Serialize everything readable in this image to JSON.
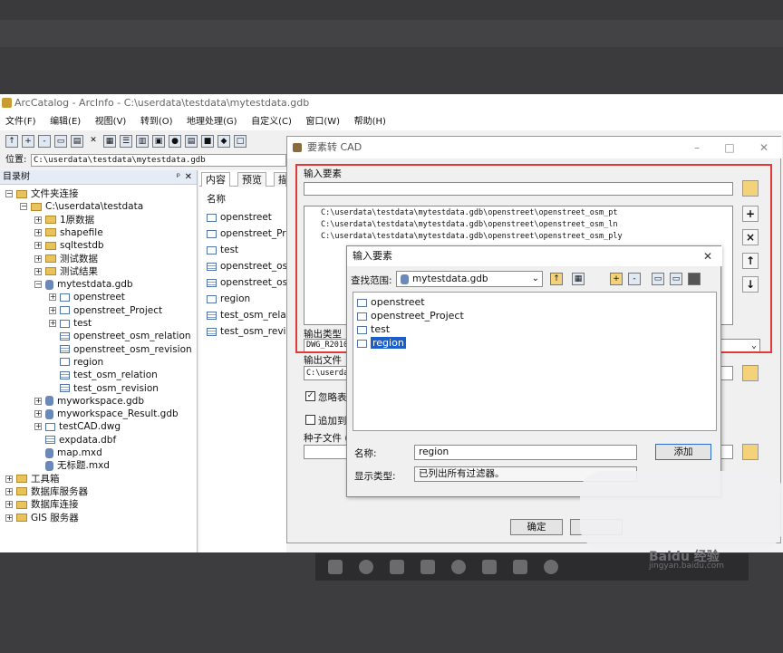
{
  "app": {
    "title": "ArcCatalog - ArcInfo - C:\\userdata\\testdata\\mytestdata.gdb",
    "menu": [
      "文件(F)",
      "编辑(E)",
      "视图(V)",
      "转到(O)",
      "地理处理(G)",
      "自定义(C)",
      "窗口(W)",
      "帮助(H)"
    ],
    "location_label": "位置:",
    "location_value": "C:\\userdata\\testdata\\mytestdata.gdb"
  },
  "tree": {
    "header": "目录树",
    "pin": "ᵖ",
    "close": "✕",
    "items": [
      {
        "label": "文件夹连接",
        "level": 0,
        "icon": "folder"
      },
      {
        "label": "C:\\userdata\\testdata",
        "level": 1,
        "icon": "folder"
      },
      {
        "label": "1原数据",
        "level": 2,
        "icon": "folder"
      },
      {
        "label": "shapefile",
        "level": 2,
        "icon": "folder"
      },
      {
        "label": "sqltestdb",
        "level": 2,
        "icon": "folder"
      },
      {
        "label": "测试数据",
        "level": 2,
        "icon": "folder"
      },
      {
        "label": "测试结果",
        "level": 2,
        "icon": "folder"
      },
      {
        "label": "mytestdata.gdb",
        "level": 2,
        "icon": "gdb"
      },
      {
        "label": "openstreet",
        "level": 3,
        "icon": "dataset"
      },
      {
        "label": "openstreet_Project",
        "level": 3,
        "icon": "dataset"
      },
      {
        "label": "test",
        "level": 3,
        "icon": "dataset"
      },
      {
        "label": "openstreet_osm_relation",
        "level": 3,
        "icon": "table"
      },
      {
        "label": "openstreet_osm_revision",
        "level": 3,
        "icon": "table"
      },
      {
        "label": "region",
        "level": 3,
        "icon": "fc"
      },
      {
        "label": "test_osm_relation",
        "level": 3,
        "icon": "table"
      },
      {
        "label": "test_osm_revision",
        "level": 3,
        "icon": "table"
      },
      {
        "label": "myworkspace.gdb",
        "level": 2,
        "icon": "gdb"
      },
      {
        "label": "myworkspace_Result.gdb",
        "level": 2,
        "icon": "gdb"
      },
      {
        "label": "testCAD.dwg",
        "level": 2,
        "icon": "dwg"
      },
      {
        "label": "expdata.dbf",
        "level": 2,
        "icon": "table"
      },
      {
        "label": "map.mxd",
        "level": 2,
        "icon": "mxd"
      },
      {
        "label": "无标题.mxd",
        "level": 2,
        "icon": "mxd"
      },
      {
        "label": "工具箱",
        "level": 0,
        "icon": "folder"
      },
      {
        "label": "数据库服务器",
        "level": 0,
        "icon": "folder"
      },
      {
        "label": "数据库连接",
        "level": 0,
        "icon": "folder"
      },
      {
        "label": "GIS 服务器",
        "level": 0,
        "icon": "folder"
      }
    ]
  },
  "content": {
    "tabs": [
      "内容",
      "预览",
      "描"
    ],
    "column": "名称",
    "items": [
      "openstreet",
      "openstreet_Pro",
      "test",
      "openstreet_osn",
      "openstreet_osr",
      "region",
      "test_osm_relati",
      "test_osm_revisi"
    ]
  },
  "dialog": {
    "title": "要素转 CAD",
    "input_label": "输入要素",
    "input_list": [
      "C:\\userdata\\testdata\\mytestdata.gdb\\openstreet\\openstreet_osm_pt",
      "C:\\userdata\\testdata\\mytestdata.gdb\\openstreet\\openstreet_osm_ln",
      "C:\\userdata\\testdata\\mytestdata.gdb\\openstreet\\openstreet_osm_ply"
    ],
    "output_type_label": "输出类型",
    "output_type_value": "DWG_R2010",
    "output_file_label": "输出文件",
    "output_file_value": "C:\\userda",
    "ignore_label": "忽略表中",
    "append_label": "追加到现",
    "seed_label": "种子文件 (",
    "ok_label": "确定"
  },
  "picker": {
    "title": "输入要素",
    "scope_label": "查找范围:",
    "scope_value": "mytestdata.gdb",
    "items": [
      "openstreet",
      "openstreet_Project",
      "test",
      "region"
    ],
    "selected_index": 3,
    "name_label": "名称:",
    "name_value": "region",
    "add_label": "添加",
    "type_label": "显示类型:",
    "type_value": "已列出所有过滤器。"
  },
  "watermark": {
    "line1": "Baidu 经验",
    "line2": "jingyan.baidu.com"
  }
}
